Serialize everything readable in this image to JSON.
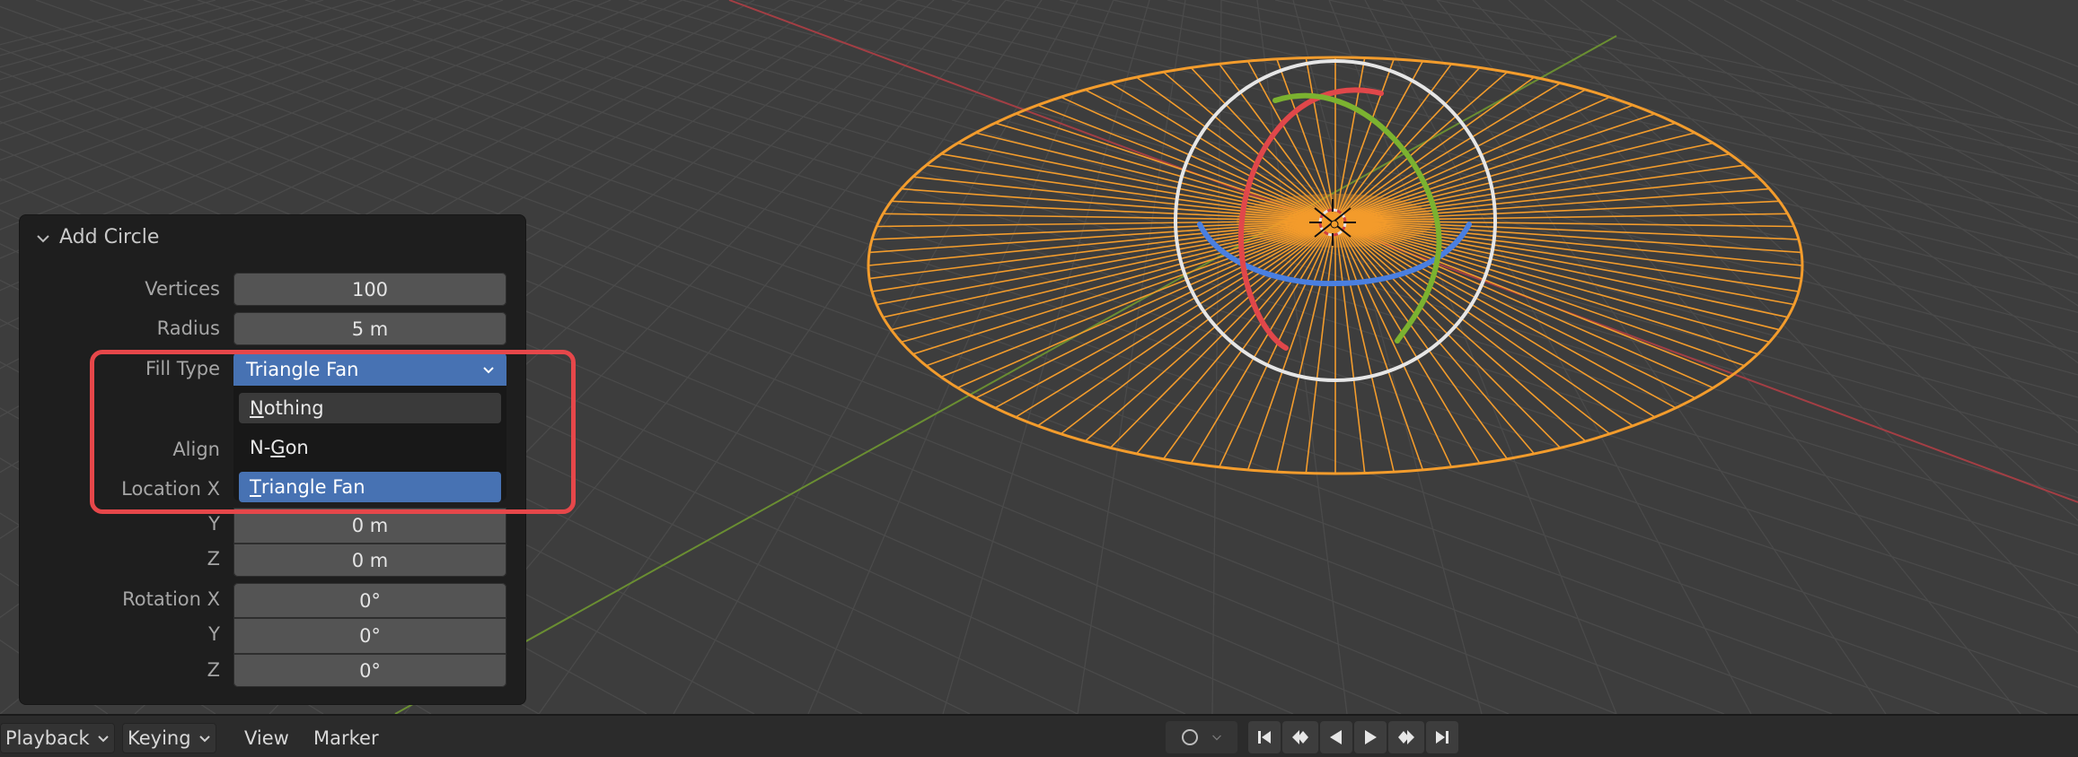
{
  "panel": {
    "title": "Add Circle",
    "rows": {
      "vertices": {
        "label": "Vertices",
        "value": "100"
      },
      "radius": {
        "label": "Radius",
        "value": "5 m"
      },
      "fill_type": {
        "label": "Fill Type",
        "value": "Triangle Fan"
      },
      "align": {
        "label": "Align"
      },
      "location_x": {
        "label": "Location X"
      },
      "location_y": {
        "label": "Y",
        "value": "0 m"
      },
      "location_z": {
        "label": "Z",
        "value": "0 m"
      },
      "rotation_x": {
        "label": "Rotation X",
        "value": "0°"
      },
      "rotation_y": {
        "label": "Y",
        "value": "0°"
      },
      "rotation_z": {
        "label": "Z",
        "value": "0°"
      }
    },
    "fill_options": [
      {
        "underline": "N",
        "rest": "othing"
      },
      {
        "before": "N-",
        "underline": "G",
        "rest": "on"
      },
      {
        "underline": "T",
        "rest": "riangle Fan"
      }
    ],
    "selected_option": "Triangle Fan"
  },
  "timeline": {
    "menus": [
      "Playback",
      "Keying",
      "View",
      "Marker"
    ]
  },
  "colors": {
    "accent": "#4772b3",
    "highlight_box": "#e6474a",
    "mesh_selected": "#f39c2c",
    "axis_x": "#e0474a",
    "axis_y": "#7bb230",
    "axis_z": "#4a7fe0"
  },
  "icons": [
    "chevron-down-icon",
    "dropdown-arrow-icon",
    "record-icon",
    "jump-start-icon",
    "prev-keyframe-icon",
    "play-reverse-icon",
    "play-icon",
    "next-keyframe-icon",
    "jump-end-icon"
  ]
}
